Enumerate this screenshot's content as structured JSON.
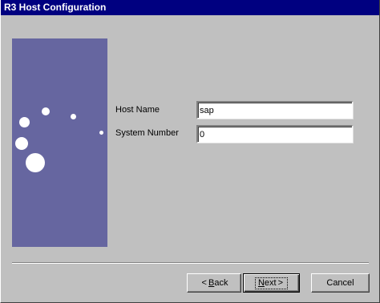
{
  "window": {
    "title": "R3 Host Configuration"
  },
  "form": {
    "host_name_label": "Host Name",
    "host_name_value": "sap",
    "system_number_label": "System Number",
    "system_number_value": "0"
  },
  "buttons": {
    "back": {
      "arrow": "<",
      "hotkey": "B",
      "rest": "ack"
    },
    "next": {
      "hotkey": "N",
      "rest": "ext",
      "arrow": ">"
    },
    "cancel": {
      "label": "Cancel"
    }
  },
  "colors": {
    "title_bar": "#000080",
    "side_panel": "#6666a0",
    "dialog_face": "#c0c0c0"
  },
  "icons": {
    "side_panel_art": "wizard-bubbles-graphic"
  }
}
